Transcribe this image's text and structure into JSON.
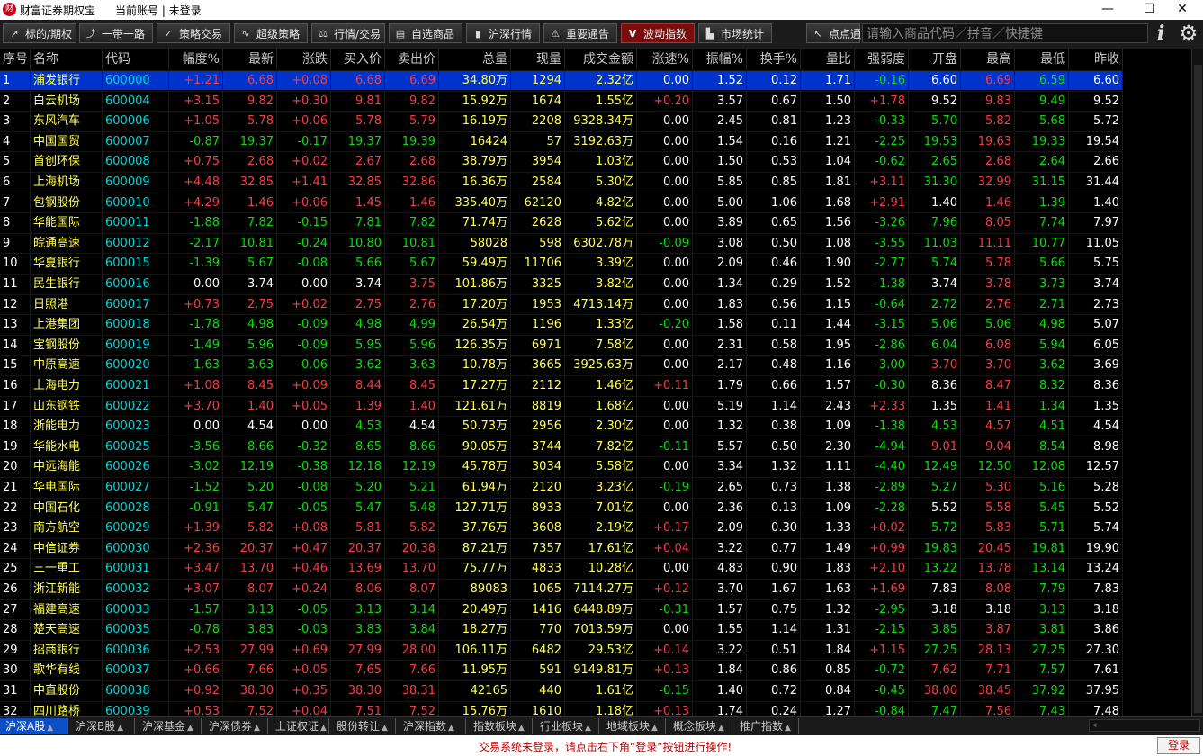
{
  "titlebar": {
    "app_title": "财富证券期权宝",
    "account": "当前账号 | 未登录",
    "minimize": "—",
    "maximize": "☐",
    "close": "✕"
  },
  "toolbar": {
    "buttons": [
      {
        "label": "标的/期权",
        "icon": "pulse-icon"
      },
      {
        "label": "一带一路",
        "icon": "trend-icon"
      },
      {
        "label": "策略交易",
        "icon": "check-icon"
      },
      {
        "label": "超级策略",
        "icon": "wave-icon"
      },
      {
        "label": "行情/交易",
        "icon": "scale-icon"
      },
      {
        "label": "自选商品",
        "icon": "cart-icon"
      },
      {
        "label": "沪深行情",
        "icon": "bars-icon"
      },
      {
        "label": "重要通告",
        "icon": "warning-icon"
      },
      {
        "label": "波动指数",
        "icon": "v-icon"
      },
      {
        "label": "市场统计",
        "icon": "building-icon"
      },
      {
        "label": "点点通",
        "icon": "pointer-icon"
      }
    ],
    "active_button": "波动指数",
    "search_placeholder": "请输入商品代码／拼音／快捷键"
  },
  "table": {
    "columns": [
      "序号",
      "名称",
      "代码",
      "幅度%",
      "最新",
      "涨跌",
      "买入价",
      "卖出价",
      "总量",
      "现量",
      "成交金额",
      "涨速%",
      "振幅%",
      "换手%",
      "量比",
      "强弱度",
      "开盘",
      "最高",
      "最低",
      "昨收"
    ],
    "selected_row": 0,
    "rows": [
      [
        "1",
        "浦发银行",
        "600000",
        "+1.21",
        "6.68",
        "+0.08",
        "6.68",
        "6.69",
        "34.80万",
        "1294",
        "2.32亿",
        "0.00",
        "1.52",
        "0.12",
        "1.71",
        "-0.16",
        "6.60",
        "6.69",
        "6.59",
        "6.60"
      ],
      [
        "2",
        "白云机场",
        "600004",
        "+3.15",
        "9.82",
        "+0.30",
        "9.81",
        "9.82",
        "15.92万",
        "1674",
        "1.55亿",
        "+0.20",
        "3.57",
        "0.67",
        "1.50",
        "+1.78",
        "9.52",
        "9.83",
        "9.49",
        "9.52"
      ],
      [
        "3",
        "东风汽车",
        "600006",
        "+1.05",
        "5.78",
        "+0.06",
        "5.78",
        "5.79",
        "16.19万",
        "2208",
        "9328.34万",
        "0.00",
        "2.45",
        "0.81",
        "1.23",
        "-0.33",
        "5.70",
        "5.82",
        "5.68",
        "5.72"
      ],
      [
        "4",
        "中国国贸",
        "600007",
        "-0.87",
        "19.37",
        "-0.17",
        "19.37",
        "19.39",
        "16424",
        "57",
        "3192.63万",
        "0.00",
        "1.54",
        "0.16",
        "1.21",
        "-2.25",
        "19.53",
        "19.63",
        "19.33",
        "19.54"
      ],
      [
        "5",
        "首创环保",
        "600008",
        "+0.75",
        "2.68",
        "+0.02",
        "2.67",
        "2.68",
        "38.79万",
        "3954",
        "1.03亿",
        "0.00",
        "1.50",
        "0.53",
        "1.04",
        "-0.62",
        "2.65",
        "2.68",
        "2.64",
        "2.66"
      ],
      [
        "6",
        "上海机场",
        "600009",
        "+4.48",
        "32.85",
        "+1.41",
        "32.85",
        "32.86",
        "16.36万",
        "2584",
        "5.30亿",
        "0.00",
        "5.85",
        "0.85",
        "1.81",
        "+3.11",
        "31.30",
        "32.99",
        "31.15",
        "31.44"
      ],
      [
        "7",
        "包钢股份",
        "600010",
        "+4.29",
        "1.46",
        "+0.06",
        "1.45",
        "1.46",
        "335.40万",
        "62120",
        "4.82亿",
        "0.00",
        "5.00",
        "1.06",
        "1.68",
        "+2.91",
        "1.40",
        "1.46",
        "1.39",
        "1.40"
      ],
      [
        "8",
        "华能国际",
        "600011",
        "-1.88",
        "7.82",
        "-0.15",
        "7.81",
        "7.82",
        "71.74万",
        "2628",
        "5.62亿",
        "0.00",
        "3.89",
        "0.65",
        "1.56",
        "-3.26",
        "7.96",
        "8.05",
        "7.74",
        "7.97"
      ],
      [
        "9",
        "皖通高速",
        "600012",
        "-2.17",
        "10.81",
        "-0.24",
        "10.80",
        "10.81",
        "58028",
        "598",
        "6302.78万",
        "-0.09",
        "3.08",
        "0.50",
        "1.08",
        "-3.55",
        "11.03",
        "11.11",
        "10.77",
        "11.05"
      ],
      [
        "10",
        "华夏银行",
        "600015",
        "-1.39",
        "5.67",
        "-0.08",
        "5.66",
        "5.67",
        "59.49万",
        "11706",
        "3.39亿",
        "0.00",
        "2.09",
        "0.46",
        "1.90",
        "-2.77",
        "5.74",
        "5.78",
        "5.66",
        "5.75"
      ],
      [
        "11",
        "民生银行",
        "600016",
        "0.00",
        "3.74",
        "0.00",
        "3.74",
        "3.75",
        "101.86万",
        "3325",
        "3.82亿",
        "0.00",
        "1.34",
        "0.29",
        "1.52",
        "-1.38",
        "3.74",
        "3.78",
        "3.73",
        "3.74"
      ],
      [
        "12",
        "日照港",
        "600017",
        "+0.73",
        "2.75",
        "+0.02",
        "2.75",
        "2.76",
        "17.20万",
        "1953",
        "4713.14万",
        "0.00",
        "1.83",
        "0.56",
        "1.15",
        "-0.64",
        "2.72",
        "2.76",
        "2.71",
        "2.73"
      ],
      [
        "13",
        "上港集团",
        "600018",
        "-1.78",
        "4.98",
        "-0.09",
        "4.98",
        "4.99",
        "26.54万",
        "1196",
        "1.33亿",
        "-0.20",
        "1.58",
        "0.11",
        "1.44",
        "-3.15",
        "5.06",
        "5.06",
        "4.98",
        "5.07"
      ],
      [
        "14",
        "宝钢股份",
        "600019",
        "-1.49",
        "5.96",
        "-0.09",
        "5.95",
        "5.96",
        "126.35万",
        "6971",
        "7.58亿",
        "0.00",
        "2.31",
        "0.58",
        "1.95",
        "-2.86",
        "6.04",
        "6.08",
        "5.94",
        "6.05"
      ],
      [
        "15",
        "中原高速",
        "600020",
        "-1.63",
        "3.63",
        "-0.06",
        "3.62",
        "3.63",
        "10.78万",
        "3665",
        "3925.63万",
        "0.00",
        "2.17",
        "0.48",
        "1.16",
        "-3.00",
        "3.70",
        "3.70",
        "3.62",
        "3.69"
      ],
      [
        "16",
        "上海电力",
        "600021",
        "+1.08",
        "8.45",
        "+0.09",
        "8.44",
        "8.45",
        "17.27万",
        "2112",
        "1.46亿",
        "+0.11",
        "1.79",
        "0.66",
        "1.57",
        "-0.30",
        "8.36",
        "8.47",
        "8.32",
        "8.36"
      ],
      [
        "17",
        "山东钢铁",
        "600022",
        "+3.70",
        "1.40",
        "+0.05",
        "1.39",
        "1.40",
        "121.61万",
        "8819",
        "1.68亿",
        "0.00",
        "5.19",
        "1.14",
        "2.43",
        "+2.33",
        "1.35",
        "1.41",
        "1.34",
        "1.35"
      ],
      [
        "18",
        "浙能电力",
        "600023",
        "0.00",
        "4.54",
        "0.00",
        "4.53",
        "4.54",
        "50.73万",
        "2956",
        "2.30亿",
        "0.00",
        "1.32",
        "0.38",
        "1.09",
        "-1.38",
        "4.53",
        "4.57",
        "4.51",
        "4.54"
      ],
      [
        "19",
        "华能水电",
        "600025",
        "-3.56",
        "8.66",
        "-0.32",
        "8.65",
        "8.66",
        "90.05万",
        "3744",
        "7.82亿",
        "-0.11",
        "5.57",
        "0.50",
        "2.30",
        "-4.94",
        "9.01",
        "9.04",
        "8.54",
        "8.98"
      ],
      [
        "20",
        "中远海能",
        "600026",
        "-3.02",
        "12.19",
        "-0.38",
        "12.18",
        "12.19",
        "45.78万",
        "3034",
        "5.58亿",
        "0.00",
        "3.34",
        "1.32",
        "1.11",
        "-4.40",
        "12.49",
        "12.50",
        "12.08",
        "12.57"
      ],
      [
        "21",
        "华电国际",
        "600027",
        "-1.52",
        "5.20",
        "-0.08",
        "5.20",
        "5.21",
        "61.94万",
        "2120",
        "3.23亿",
        "-0.19",
        "2.65",
        "0.73",
        "1.38",
        "-2.89",
        "5.27",
        "5.30",
        "5.16",
        "5.28"
      ],
      [
        "22",
        "中国石化",
        "600028",
        "-0.91",
        "5.47",
        "-0.05",
        "5.47",
        "5.48",
        "127.71万",
        "8933",
        "7.01亿",
        "0.00",
        "2.36",
        "0.13",
        "1.09",
        "-2.28",
        "5.52",
        "5.58",
        "5.45",
        "5.52"
      ],
      [
        "23",
        "南方航空",
        "600029",
        "+1.39",
        "5.82",
        "+0.08",
        "5.81",
        "5.82",
        "37.76万",
        "3608",
        "2.19亿",
        "+0.17",
        "2.09",
        "0.30",
        "1.33",
        "+0.02",
        "5.72",
        "5.83",
        "5.71",
        "5.74"
      ],
      [
        "24",
        "中信证券",
        "600030",
        "+2.36",
        "20.37",
        "+0.47",
        "20.37",
        "20.38",
        "87.21万",
        "7357",
        "17.61亿",
        "+0.04",
        "3.22",
        "0.77",
        "1.49",
        "+0.99",
        "19.83",
        "20.45",
        "19.81",
        "19.90"
      ],
      [
        "25",
        "三一重工",
        "600031",
        "+3.47",
        "13.70",
        "+0.46",
        "13.69",
        "13.70",
        "75.77万",
        "4833",
        "10.28亿",
        "0.00",
        "4.83",
        "0.90",
        "1.83",
        "+2.10",
        "13.22",
        "13.78",
        "13.14",
        "13.24"
      ],
      [
        "26",
        "浙江新能",
        "600032",
        "+3.07",
        "8.07",
        "+0.24",
        "8.06",
        "8.07",
        "89083",
        "1065",
        "7114.27万",
        "+0.12",
        "3.70",
        "1.67",
        "1.63",
        "+1.69",
        "7.83",
        "8.08",
        "7.79",
        "7.83"
      ],
      [
        "27",
        "福建高速",
        "600033",
        "-1.57",
        "3.13",
        "-0.05",
        "3.13",
        "3.14",
        "20.49万",
        "1416",
        "6448.89万",
        "-0.31",
        "1.57",
        "0.75",
        "1.32",
        "-2.95",
        "3.18",
        "3.18",
        "3.13",
        "3.18"
      ],
      [
        "28",
        "楚天高速",
        "600035",
        "-0.78",
        "3.83",
        "-0.03",
        "3.83",
        "3.84",
        "18.27万",
        "770",
        "7013.59万",
        "0.00",
        "1.55",
        "1.14",
        "1.31",
        "-2.15",
        "3.85",
        "3.87",
        "3.81",
        "3.86"
      ],
      [
        "29",
        "招商银行",
        "600036",
        "+2.53",
        "27.99",
        "+0.69",
        "27.99",
        "28.00",
        "106.11万",
        "6482",
        "29.53亿",
        "+0.14",
        "3.22",
        "0.51",
        "1.84",
        "+1.15",
        "27.25",
        "28.13",
        "27.25",
        "27.30"
      ],
      [
        "30",
        "歌华有线",
        "600037",
        "+0.66",
        "7.66",
        "+0.05",
        "7.65",
        "7.66",
        "11.95万",
        "591",
        "9149.81万",
        "+0.13",
        "1.84",
        "0.86",
        "0.85",
        "-0.72",
        "7.62",
        "7.71",
        "7.57",
        "7.61"
      ],
      [
        "31",
        "中直股份",
        "600038",
        "+0.92",
        "38.30",
        "+0.35",
        "38.30",
        "38.31",
        "42165",
        "440",
        "1.61亿",
        "-0.15",
        "1.40",
        "0.72",
        "0.84",
        "-0.45",
        "38.00",
        "38.45",
        "37.92",
        "37.95"
      ],
      [
        "32",
        "四川路桥",
        "600039",
        "+0.53",
        "7.52",
        "+0.04",
        "7.51",
        "7.52",
        "15.76万",
        "1610",
        "1.18亿",
        "+0.13",
        "1.74",
        "0.24",
        "1.27",
        "-0.84",
        "7.47",
        "7.56",
        "7.43",
        "7.48"
      ]
    ]
  },
  "tabs": {
    "items": [
      "沪深A股",
      "沪深B股",
      "沪深基金",
      "沪深债券",
      "上证权证",
      "股份转让",
      "沪深指数",
      "指数板块",
      "行业板块",
      "地域板块",
      "概念板块",
      "推广指数"
    ],
    "active": 0
  },
  "status": {
    "message": "交易系统未登录，请点击右下角“登录”按钮进行操作!",
    "login_label": "登录"
  }
}
